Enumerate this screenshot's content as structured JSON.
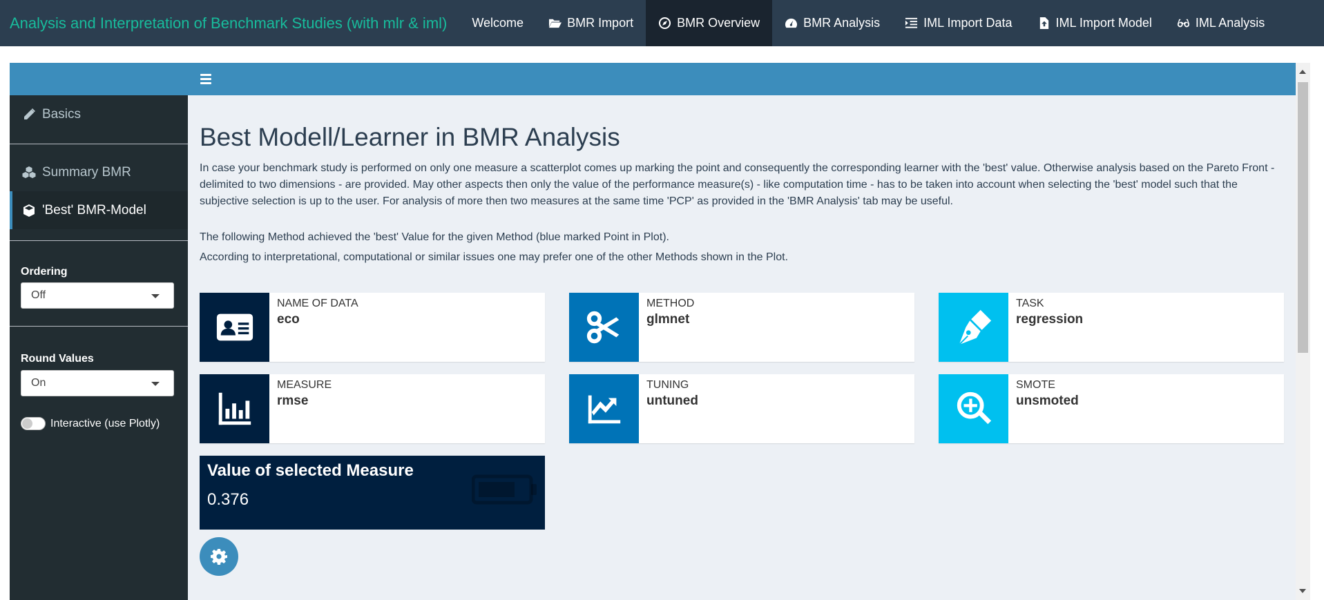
{
  "navbar": {
    "brand": "Analysis and Interpretation of Benchmark Studies (with mlr & iml)",
    "tabs": [
      {
        "label": "Welcome",
        "icon": "none"
      },
      {
        "label": "BMR Import",
        "icon": "folder-open-icon"
      },
      {
        "label": "BMR Overview",
        "icon": "compass-icon",
        "active": true
      },
      {
        "label": "BMR Analysis",
        "icon": "tachometer-icon"
      },
      {
        "label": "IML Import Data",
        "icon": "indent-icon"
      },
      {
        "label": "IML Import Model",
        "icon": "file-upload-icon"
      },
      {
        "label": "IML Analysis",
        "icon": "glasses-icon"
      }
    ]
  },
  "sidebar": {
    "items": [
      {
        "label": "Basics",
        "icon": "pencil-icon"
      },
      {
        "label": "Summary BMR",
        "icon": "cubes-icon"
      },
      {
        "label": "'Best' BMR-Model",
        "icon": "cube-icon",
        "active": true
      }
    ],
    "ordering": {
      "label": "Ordering",
      "value": "Off"
    },
    "round_values": {
      "label": "Round Values",
      "value": "On"
    },
    "interactive": {
      "label": "Interactive (use Plotly)",
      "checked": false
    }
  },
  "main": {
    "title": "Best Modell/Learner in BMR Analysis",
    "intro": "In case your benchmark study is performed on only one measure a scatterplot comes up marking the point and consequently the corresponding learner with the 'best' value. Otherwise analysis based on the Pareto Front - delimited to two dimensions - are provided. May other aspects then only the value of the performance measure(s) - like computation time - has to be taken into account when selecting the 'best' model such that the subjective selection is up to the user. For analysis of more then two measures at the same time 'PCP' as provided in the 'BMR Analysis' tab may be useful.",
    "note1": "The following Method achieved the 'best' Value for the given Method (blue marked Point in Plot).",
    "note2": "According to interpretational, computational or similar issues one may prefer one of the other Methods shown in the Plot.",
    "info_boxes": [
      {
        "label": "Name of Data",
        "value": "eco",
        "icon": "id-card-icon",
        "color": "#001f3f"
      },
      {
        "label": "Method",
        "value": "glmnet",
        "icon": "scissors-icon",
        "color": "#0073b7"
      },
      {
        "label": "Task",
        "value": "regression",
        "icon": "pen-nib-icon",
        "color": "#00c0ef"
      },
      {
        "label": "Measure",
        "value": "rmse",
        "icon": "bar-chart-icon",
        "color": "#001f3f"
      },
      {
        "label": "Tuning",
        "value": "untuned",
        "icon": "line-chart-icon",
        "color": "#0073b7"
      },
      {
        "label": "Smote",
        "value": "unsmoted",
        "icon": "search-plus-icon",
        "color": "#00c0ef"
      }
    ],
    "value_box": {
      "title": "Value of selected Measure",
      "value": "0.376",
      "icon": "battery-icon",
      "color": "#001f3f"
    }
  }
}
